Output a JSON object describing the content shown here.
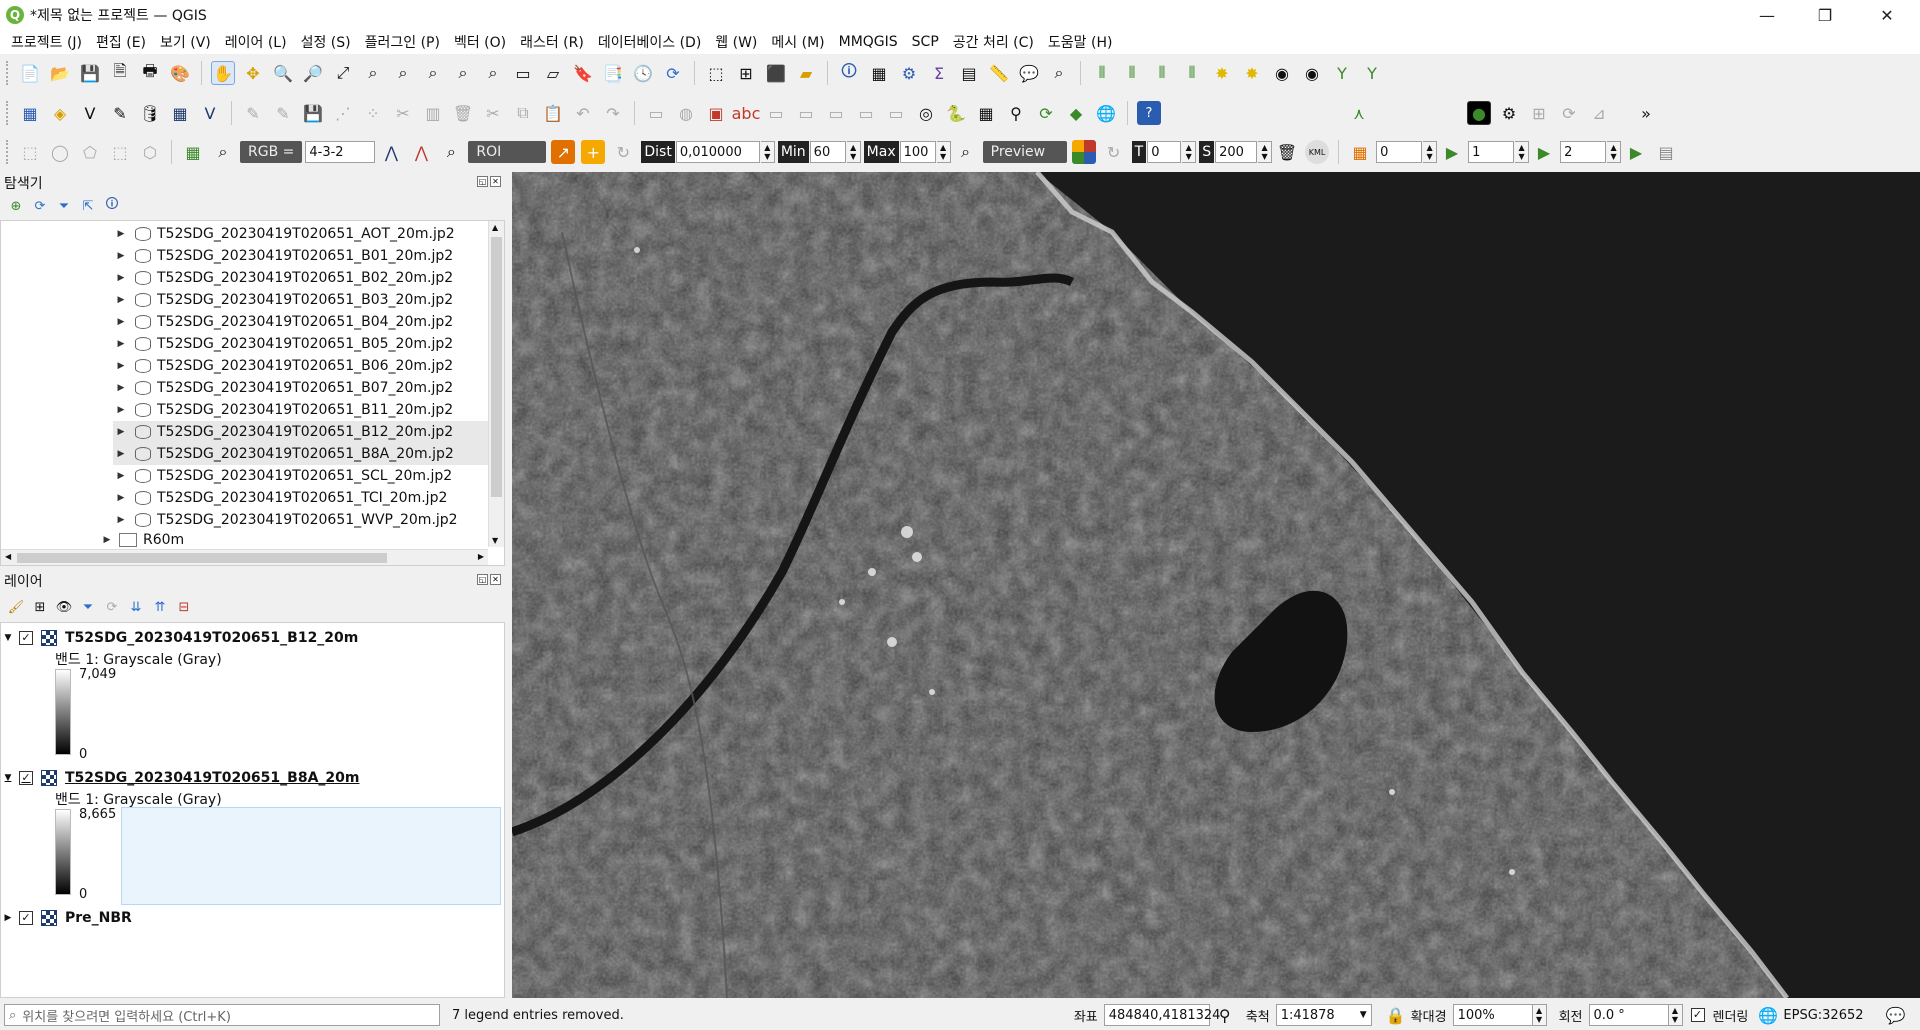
{
  "window": {
    "title": "*제목 없는 프로젝트 — QGIS",
    "controls": [
      "—",
      "❐",
      "✕"
    ]
  },
  "menu": [
    "프로젝트 (J)",
    "편집 (E)",
    "보기 (V)",
    "레이어 (L)",
    "설정 (S)",
    "플러그인 (P)",
    "벡터 (O)",
    "래스터 (R)",
    "데이터베이스 (D)",
    "웹 (W)",
    "메시 (M)",
    "MMQGIS",
    "SCP",
    "공간 처리 (C)",
    "도움말 (H)"
  ],
  "scp_toolbar": {
    "rgb_label": "RGB =",
    "rgb_value": "4-3-2",
    "roi_label": "ROI",
    "dist_label": "Dist",
    "dist_value": "0,010000",
    "min_label": "Min",
    "min_value": "60",
    "max_label": "Max",
    "max_value": "100",
    "preview_label": "Preview",
    "t_label": "T",
    "t_value": "0",
    "s_label": "S",
    "s_value": "200",
    "kml_label": "KML",
    "field1": "0",
    "field2": "1",
    "field3": "2"
  },
  "browser": {
    "title": "탐색기",
    "items": [
      "T52SDG_20230419T020651_AOT_20m.jp2",
      "T52SDG_20230419T020651_B01_20m.jp2",
      "T52SDG_20230419T020651_B02_20m.jp2",
      "T52SDG_20230419T020651_B03_20m.jp2",
      "T52SDG_20230419T020651_B04_20m.jp2",
      "T52SDG_20230419T020651_B05_20m.jp2",
      "T52SDG_20230419T020651_B06_20m.jp2",
      "T52SDG_20230419T020651_B07_20m.jp2",
      "T52SDG_20230419T020651_B11_20m.jp2",
      "T52SDG_20230419T020651_B12_20m.jp2",
      "T52SDG_20230419T020651_B8A_20m.jp2",
      "T52SDG_20230419T020651_SCL_20m.jp2",
      "T52SDG_20230419T020651_TCI_20m.jp2",
      "T52SDG_20230419T020651_WVP_20m.jp2"
    ],
    "folder": "R60m"
  },
  "layers": {
    "title": "레이어",
    "items": [
      {
        "name": "T52SDG_20230419T020651_B12_20m",
        "band": "밴드 1: Grayscale (Gray)",
        "max": "7,049",
        "min": "0"
      },
      {
        "name": "T52SDG_20230419T020651_B8A_20m",
        "band": "밴드 1: Grayscale (Gray)",
        "max": "8,665",
        "min": "0"
      },
      {
        "name": "Pre_NBR"
      }
    ]
  },
  "status": {
    "search_placeholder": "위치를 찾으려면 입력하세요 (Ctrl+K)",
    "message": "7 legend entries removed.",
    "coord_label": "좌표",
    "coord_value": "484840,4181324",
    "scale_label": "축척",
    "scale_value": "1:41878",
    "magnify_label": "확대경",
    "magnify_value": "100%",
    "rotation_label": "회전",
    "rotation_value": "0.0 °",
    "render_label": "렌더링",
    "crs": "EPSG:32652"
  }
}
